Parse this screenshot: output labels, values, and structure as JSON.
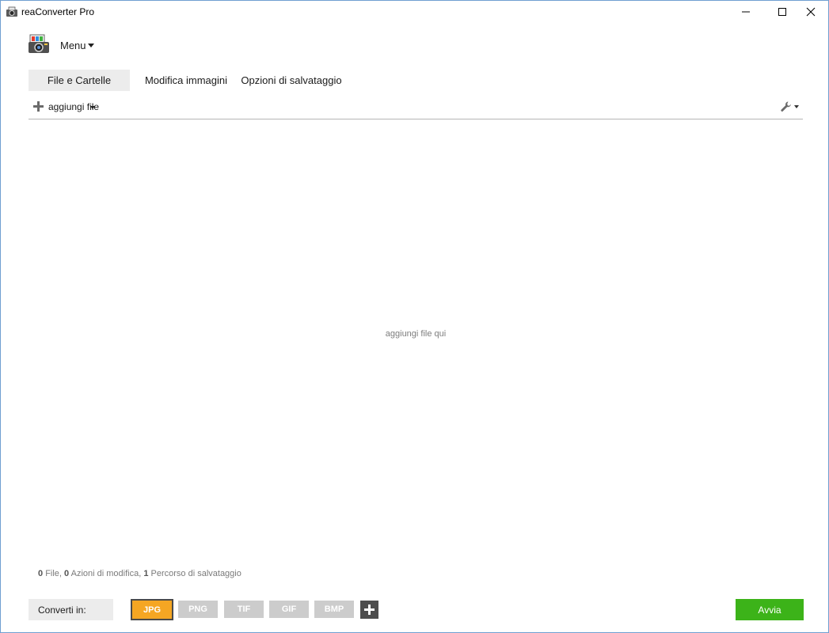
{
  "window": {
    "title": "reaConverter Pro",
    "minimize_glyph": "—",
    "maximize_glyph": "☐",
    "close_glyph": "✕"
  },
  "menu": {
    "label": "Menu"
  },
  "tabs": [
    {
      "label": "File e Cartelle",
      "active": true
    },
    {
      "label": "Modifica immagini",
      "active": false
    },
    {
      "label": "Opzioni di salvataggio",
      "active": false
    }
  ],
  "toolbar": {
    "add_files_label": "aggiungi file"
  },
  "drop_area": {
    "hint": "aggiungi file qui"
  },
  "status": {
    "files_count": "0",
    "files_label": "File,",
    "actions_count": "0",
    "actions_label": "Azioni di modifica,",
    "paths_count": "1",
    "paths_label": "Percorso di salvataggio"
  },
  "bottom": {
    "convert_label": "Converti in:",
    "formats": [
      {
        "label": "JPG",
        "selected": true
      },
      {
        "label": "PNG",
        "selected": false
      },
      {
        "label": "TIF",
        "selected": false
      },
      {
        "label": "GIF",
        "selected": false
      },
      {
        "label": "BMP",
        "selected": false
      }
    ],
    "start_label": "Avvia"
  },
  "colors": {
    "accent_selected_format": "#f5a623",
    "start_button": "#3cb319",
    "inactive_format": "#cccccc",
    "tab_active_bg": "#ececec"
  },
  "icons": [
    "app-icon",
    "menu-logo-icon",
    "caret-down-icon",
    "plus-icon",
    "wrench-icon",
    "add-format-icon"
  ]
}
